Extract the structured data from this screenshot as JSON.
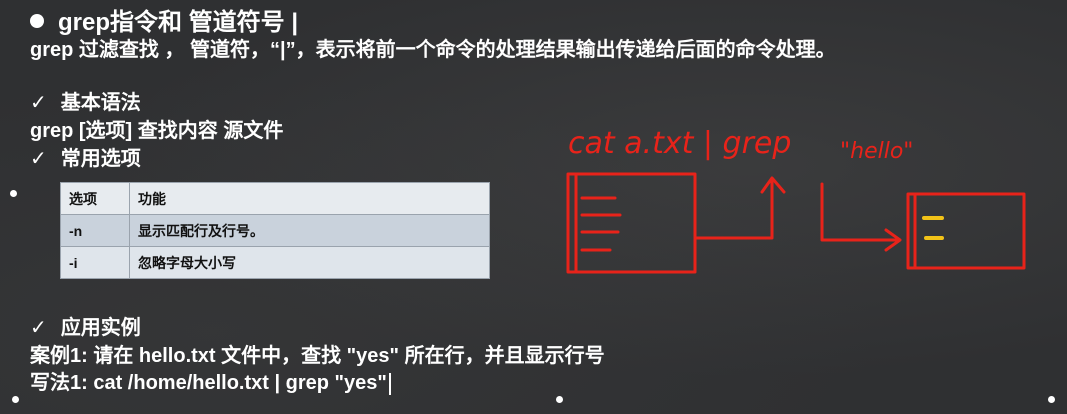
{
  "title": "grep指令和 管道符号 |",
  "intro": "grep 过滤查找 ， 管道符，“|”，表示将前一个命令的处理结果输出传递给后面的命令处理。",
  "section1": {
    "check": "✓",
    "label": "基本语法"
  },
  "syntax": "grep [选项] 查找内容 源文件",
  "section2": {
    "check": "✓",
    "label": "常用选项"
  },
  "table": {
    "headers": [
      "选项",
      "功能"
    ],
    "rows": [
      [
        "-n",
        "显示匹配行及行号。"
      ],
      [
        "-i",
        "忽略字母大小写"
      ]
    ]
  },
  "section3": {
    "check": "✓",
    "label": "应用实例"
  },
  "example1": "案例1: 请在 hello.txt 文件中，查找 \"yes\" 所在行，并且显示行号",
  "writing1": "写法1:  cat /home/hello.txt  | grep \"yes\"",
  "sketch": {
    "cmd_left": "cat a.txt | grep",
    "cmd_quoted": "\"hello\"",
    "ink_color": "#e8231a",
    "highlight_color": "#f2c318"
  }
}
